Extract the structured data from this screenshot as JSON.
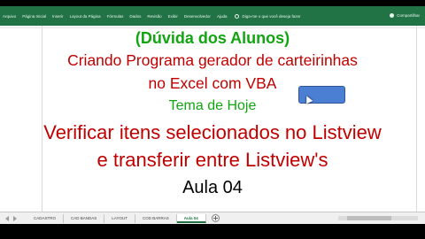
{
  "ribbon": {
    "tabs": [
      "Arquivo",
      "Página Inicial",
      "Inserir",
      "Layout da Página",
      "Fórmulas",
      "Dados",
      "Revisão",
      "Exibir",
      "Desenvolvedor",
      "Ajuda"
    ],
    "tell_me": "Diga-me o que você deseja fazer",
    "share": "Compartilhar",
    "color": "#217346"
  },
  "content": {
    "line1": "(Dúvida dos Alunos)",
    "line2": "Criando Programa gerador de carteirinhas",
    "line3": "no Excel com VBA",
    "line4": "Tema de Hoje",
    "line5": "Verificar itens selecionados no Listview",
    "line6": "e transferir entre Listview's",
    "line7": "Aula 04"
  },
  "sheet_tabs": [
    "CADASTRO",
    "CAD BANDAS",
    "LAYOUT",
    "COD BARRAS",
    "Aula 04"
  ],
  "active_sheet": "Aula 04"
}
